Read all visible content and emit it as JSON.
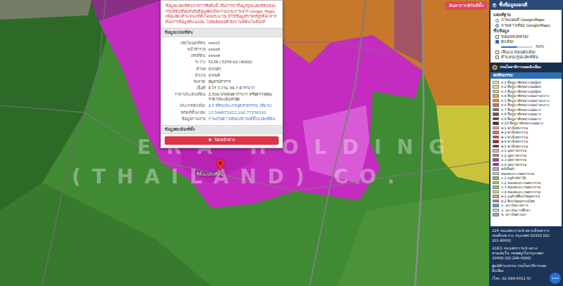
{
  "map": {
    "watermark": [
      "ERA HOLDING",
      "(THAILAND) CO."
    ],
    "search_button": "ค้นหาจากพิกัดที่ตั้ง",
    "pin": {
      "label": "ที่ตั้งแปลงที่ดิน"
    }
  },
  "popup": {
    "warning": "ข้อมูลแปลงที่ดินจากการสืบค้นนี้ เป็นการนำข้อมูลรูปแปลงที่ดินของกรมที่ดินซ้อนทับกับข้อมูลผังเมืองรวมและภาพจาก Google Maps เพื่อแสดงตำแหน่งที่ตั้งโดยประมาณ มิใช่ข้อมูลรังวัดที่ถูกต้อง หากต้องการข้อมูลที่แน่นอน โปรดติดต่อสำนักงานที่ดินในท้องที่",
    "section_title": "ข้อมูลแปลงที่ดิน",
    "rows": [
      {
        "label": "เลขโฉนดที่ดิน",
        "value": "xxxx3",
        "link": false
      },
      {
        "label": "หน้าสำรวจ",
        "value": "xxxx8",
        "link": false
      },
      {
        "label": "เลขที่ดิน",
        "value": "xxxx4",
        "link": false
      },
      {
        "label": "ระวาง",
        "value": "5136 I 5256-02 (4000)",
        "link": false
      },
      {
        "label": "ตำบล",
        "value": "บางปลา",
        "link": false
      },
      {
        "label": "อำเภอ",
        "value": "บางพลี",
        "link": false
      },
      {
        "label": "จังหวัด",
        "value": "สมุทรปราการ",
        "link": false
      },
      {
        "label": "เนื้อที่",
        "value": "8 ไร่ 3 งาน 39.7 ตารางวา",
        "link": false
      },
      {
        "label": "ราคาประเมินที่ดิน",
        "value": "2,500 บาทต่อตารางวา หรือตรวจสอบราคาประเมินล่าสุด",
        "link": false
      },
      {
        "label": "ประเภทผังเมือง",
        "value": "อ.2 ที่ดินประเภทอุตสาหกรรม (สีม่วง)",
        "link": true
      },
      {
        "label": "พิกัดที่ตั้งแปลง",
        "value": "13.544071812,100.77238191",
        "link": true
      },
      {
        "label": "ข้อมูลภาพถ่าย",
        "value": "ภาพถ่ายดาวเทียมบริเวณที่ตั้งแปลงที่ดิน",
        "link": true
      }
    ],
    "second_section": "ข้อมูลผังเมืองที่ตั้ง",
    "close_icon": "✖",
    "close_button": "ปิดหน้าต่าง"
  },
  "panel": {
    "title": "ชั้นข้อมูลแผนที่",
    "basemap_title": "แผนที่ฐาน",
    "basemaps": [
      {
        "label": "ภาพแผนที่ GoogleMaps",
        "selected": false
      },
      {
        "label": "ภาพดาวเทียม GoogleMaps",
        "selected": true
      }
    ],
    "layers_title": "ชั้นข้อมูล",
    "layers": [
      {
        "kind": "checkbox",
        "label": "ขอบเขตปกครอง",
        "checked": false
      },
      {
        "kind": "slider",
        "label": "ผังเมือง",
        "checked": true,
        "level": 0.5,
        "reading": "50%"
      },
      {
        "kind": "checkbox",
        "label": "เส้นแนวถนนผังเมือง",
        "checked": false
      },
      {
        "kind": "checkbox",
        "label": "ตำแหน่งรูปแปลงที่ดิน",
        "checked": false
      }
    ],
    "agency": "กรมโยธาธิการและผังเมือง",
    "legend_title": "ผังสีกิจกรรม",
    "legend": [
      {
        "label": "ย.1 ที่อยู่อาศัยหนาแน่นน้อย",
        "color": "#fff6a0"
      },
      {
        "label": "ย.2 ที่อยู่อาศัยหนาแน่นน้อย",
        "color": "#ffe96b"
      },
      {
        "label": "ย.3 ที่อยู่อาศัยหนาแน่นน้อย",
        "color": "#ffd64a"
      },
      {
        "label": "ย.4 ที่อยู่อาศัยหนาแน่นปานกลาง",
        "color": "#f7a64a"
      },
      {
        "label": "ย.5 ที่อยู่อาศัยหนาแน่นปานกลาง",
        "color": "#f28a2e"
      },
      {
        "label": "ย.6 ที่อยู่อาศัยหนาแน่นปานกลาง",
        "color": "#e0701f"
      },
      {
        "label": "ย.7 ที่อยู่อาศัยหนาแน่นมาก",
        "color": "#a8612a"
      },
      {
        "label": "ย.8 ที่อยู่อาศัยหนาแน่นมาก",
        "color": "#8a4a1e"
      },
      {
        "label": "ย.9 ที่อยู่อาศัยหนาแน่นมาก",
        "color": "#6b3414"
      },
      {
        "label": "ย.10 ที่อยู่อาศัยหนาแน่นมาก",
        "color": "#552810"
      },
      {
        "label": "พ.1 พาณิชยกรรม",
        "color": "#f5a3a3"
      },
      {
        "label": "พ.2 พาณิชยกรรม",
        "color": "#ee6b6b"
      },
      {
        "label": "พ.3 พาณิชยกรรม",
        "color": "#e03a3a"
      },
      {
        "label": "พ.4 พาณิชยกรรม",
        "color": "#c41e1e"
      },
      {
        "label": "พ.5 พาณิชยกรรม",
        "color": "#9a0f0f"
      },
      {
        "label": "อ.1 อุตสาหกรรม",
        "color": "#e9a6e6"
      },
      {
        "label": "อ.2 อุตสาหกรรม",
        "color": "#d35fd0"
      },
      {
        "label": "อ.3 อุตสาหกรรม",
        "color": "#b82fb6"
      },
      {
        "label": "อ.4 อุตสาหกรรม",
        "color": "#8d1f8b"
      },
      {
        "label": "คลังสินค้า",
        "color": "#c9a0dc"
      },
      {
        "label": "ชนบทและเกษตรกรรม",
        "color": "#c6e9a4"
      },
      {
        "label": "ก.1 อนุรักษ์ป่าไม้",
        "color": "#7ac46b"
      },
      {
        "label": "ก.2 ชนบทและเกษตรกรรม",
        "color": "#a6d96a"
      },
      {
        "label": "ก.3 ชนบทและเกษตรกรรม",
        "color": "#9cc85a"
      },
      {
        "label": "ก.4 ชนบทและเกษตรกรรม",
        "color": "#d8e8a4"
      },
      {
        "label": "ศ.1 อนุรักษ์ศิลปวัฒนธรรม",
        "color": "#c9a78a"
      },
      {
        "label": "ศ.2 ศิลปวัฒนธรรมไทย",
        "color": "#b08a6a"
      },
      {
        "label": "ส. สถาบันราชการ",
        "color": "#5aa0e0"
      },
      {
        "label": "ล. สถาบันการศึกษา",
        "color": "#c2e4f5"
      },
      {
        "label": "ช. สถาบันศาสนา",
        "color": "#7fb0d8"
      }
    ],
    "footer": [
      "224 ถนนพระราม 9 แขวงห้วยขวาง เขตห้วยขวาง กรุงเทพฯ 10310 (02-201-8000)",
      "218/1 ถนนพระราม 6 แขวงสามเสนใน เขตพญาไท กรุงเทพฯ 10400 (02-299-4000)",
      "ศูนย์ดำรงธรรม กรมโยธาธิการและผังเมือง",
      "(โทร. 02-299-4311-5)"
    ]
  },
  "chat_button": "•••"
}
